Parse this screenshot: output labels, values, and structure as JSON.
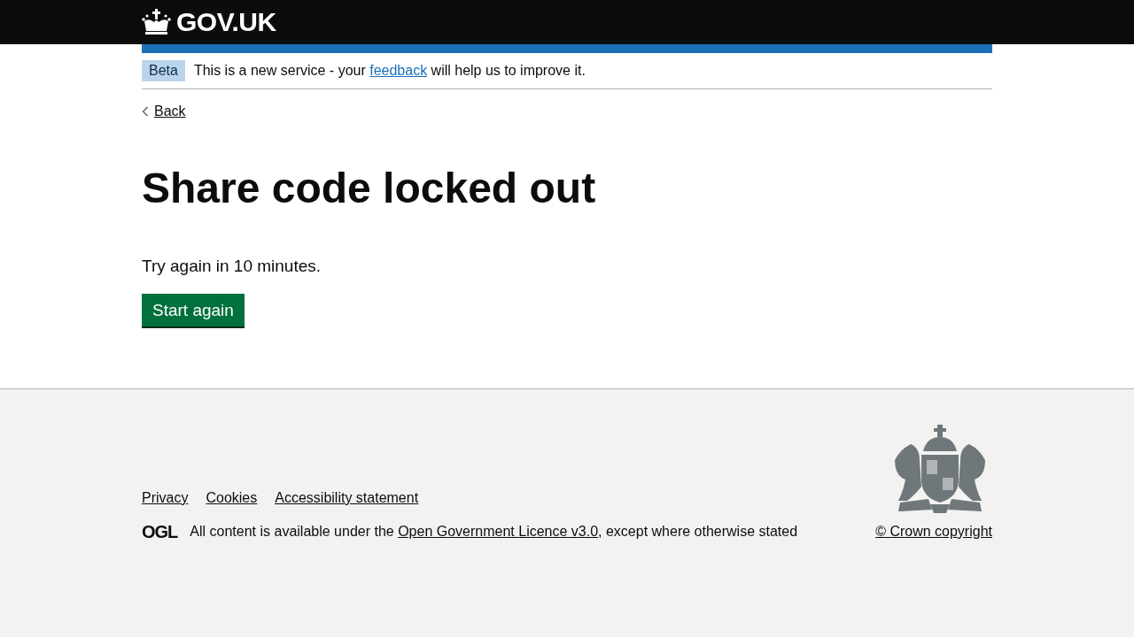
{
  "header": {
    "logo_text": "GOV.UK"
  },
  "phase_banner": {
    "tag": "Beta",
    "text_before": "This is a new service - your ",
    "link": "feedback",
    "text_after": " will help us to improve it."
  },
  "back_link": "Back",
  "heading": "Share code locked out",
  "body": "Try again in 10 minutes.",
  "button": "Start again",
  "footer": {
    "links": [
      "Privacy",
      "Cookies",
      "Accessibility statement"
    ],
    "licence_logo": "OGL",
    "licence_before": "All content is available under the ",
    "licence_link": "Open Government Licence v3.0",
    "licence_after": ", except where otherwise stated",
    "copyright": "© Crown copyright"
  }
}
